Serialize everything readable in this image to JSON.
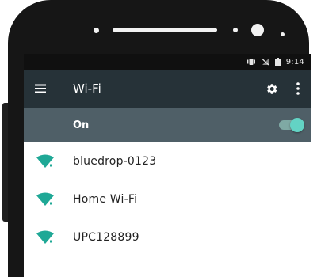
{
  "status_bar": {
    "time": "9:14"
  },
  "app_bar": {
    "title": "Wi-Fi"
  },
  "wifi_toggle": {
    "label": "On",
    "enabled": true
  },
  "networks": [
    {
      "ssid": "bluedrop-0123",
      "icon": "wifi-signal-icon"
    },
    {
      "ssid": "Home Wi-Fi",
      "icon": "wifi-signal-icon"
    },
    {
      "ssid": "UPC128899",
      "icon": "wifi-signal-icon"
    }
  ],
  "colors": {
    "app_bar": "#263238",
    "toggle_row": "#4f5f67",
    "accent": "#1fa896",
    "switch_thumb": "#63d3c4"
  }
}
